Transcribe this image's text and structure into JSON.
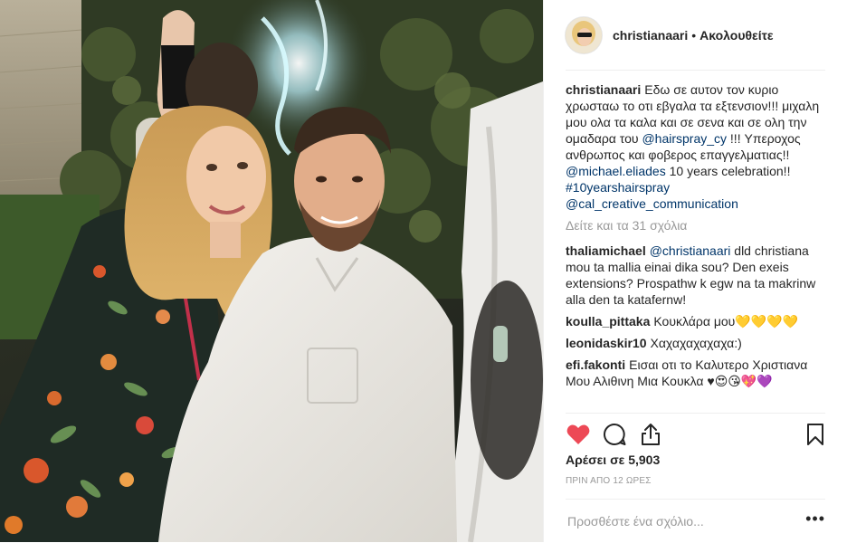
{
  "header": {
    "username": "christianaari",
    "separator": "•",
    "follow_label": "Ακολουθείτε"
  },
  "caption": {
    "username": "christianaari",
    "text_1": "Εδω σε αυτον τον κυριο χρωσταω το οτι εβγαλα τα εξτενσιον!!! μιχαλη μου ολα τα καλα και σε σενα και σε ολη την ομαδαρα του ",
    "mention_1": "@hairspray_cy",
    "text_2": " !!! Υπεροχος ανθρωπος και φοβερος επαγγελματιας!! ",
    "mention_2": "@michael.eliades",
    "text_3": " 10 years celebration!! ",
    "mention_3": "#10yearshairspray",
    "text_4": " ",
    "mention_4": "@cal_creative_communication"
  },
  "view_more": "Δείτε και τα 31 σχόλια",
  "comments": [
    {
      "username": "thaliamichael",
      "mention": "@christianaari",
      "text": " dld christiana mou ta mallia einai dika sou? Den exeis extensions? Prospathw k egw na ta makrinw alla den ta katafernw!"
    },
    {
      "username": "koulla_pittaka",
      "text": "Κουκλάρα μου💛💛💛💛"
    },
    {
      "username": "leonidaskir10",
      "text": "Χαχαχαχαχαχα:)"
    },
    {
      "username": "efi.fakonti",
      "text": "Εισαι οτι το Καλυτερο Χριστιανα Μου Αλιθινη Μια Κουκλα ♥😍😘💖💜"
    }
  ],
  "likes": "Αρέσει σε 5,903",
  "timestamp": "ΠΡΙΝ ΑΠΟ 12 ΩΡΕΣ",
  "add_comment_placeholder": "Προσθέστε ένα σχόλιο...",
  "more_options": "•••",
  "icons": {
    "like": "heart-icon",
    "comment": "comment-icon",
    "share": "share-icon",
    "save": "bookmark-icon"
  },
  "colors": {
    "liked_heart": "#ed4956",
    "mention": "#003569",
    "muted": "#999999",
    "text": "#262626"
  }
}
